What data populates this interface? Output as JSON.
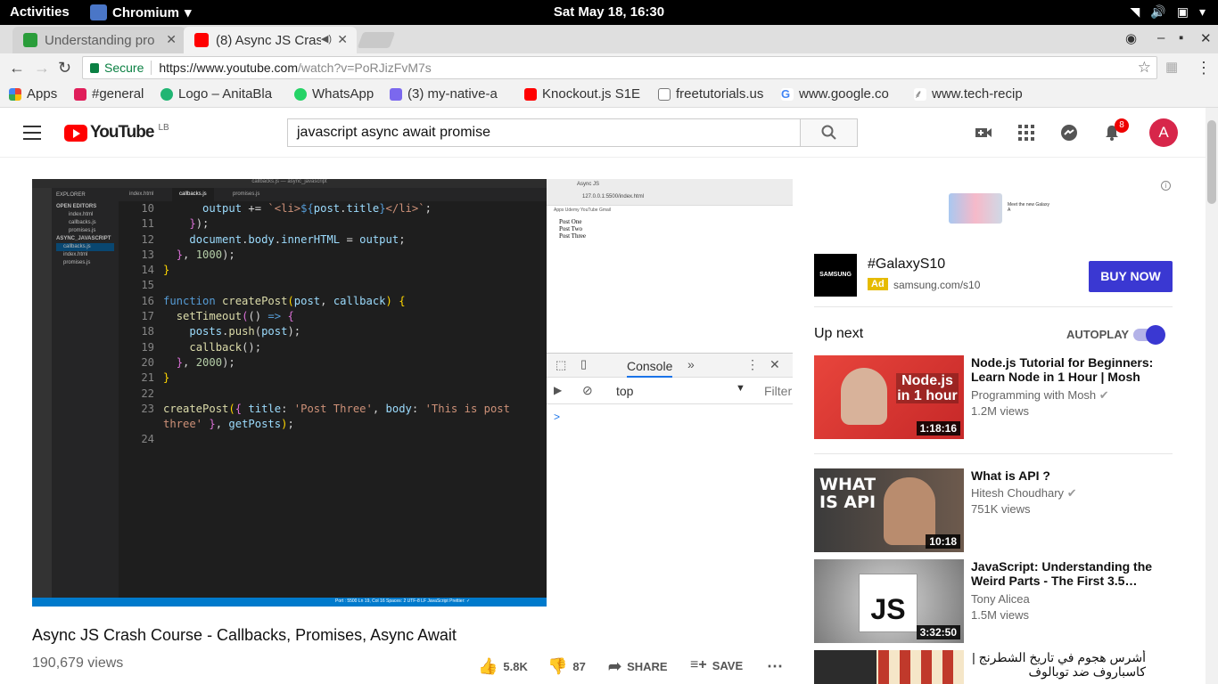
{
  "topbar": {
    "activities": "Activities",
    "app_name": "Chromium",
    "clock": "Sat May 18, 16:30"
  },
  "tabs": [
    {
      "label": "Understanding pro"
    },
    {
      "label": "(8) Async JS Cras"
    }
  ],
  "omnibox": {
    "secure": "Secure",
    "url_host": "https://www.youtube.com",
    "url_path": "/watch?v=PoRJizFvM7s"
  },
  "bookmarks": [
    {
      "label": "Apps",
      "color": "#4285f4"
    },
    {
      "label": "#general",
      "color": "#e01e5a"
    },
    {
      "label": "Logo – AnitaBla",
      "color": "#21b573"
    },
    {
      "label": "WhatsApp",
      "color": "#25d366"
    },
    {
      "label": "(3) my-native-a",
      "color": "#7b68ee"
    },
    {
      "label": "Knockout.js S1E",
      "color": "#ff0000"
    },
    {
      "label": "freetutorials.us",
      "color": "#888888"
    },
    {
      "label": "www.google.co",
      "color": "#4285f4"
    },
    {
      "label": "www.tech-recip",
      "color": "#888888"
    }
  ],
  "youtube": {
    "logo_text": "YouTube",
    "region": "LB",
    "search_value": "javascript async await promise",
    "notification_count": "8",
    "avatar_letter": "A",
    "brand_color": "#ff0000",
    "accent_color": "#3a38d2"
  },
  "player": {
    "window_title": "callbacks.js — async_javascript",
    "explorer": "EXPLORER",
    "open_editors": "OPEN EDITORS",
    "project": "ASYNC_JAVASCRIPT",
    "files": [
      "index.html",
      "callbacks.js",
      "promises.js"
    ],
    "editor_tabs": [
      "index.html",
      "callbacks.js",
      "promises.js"
    ],
    "statusbar": "Port : 5500   Ln 19, Col 16   Spaces: 2   UTF-8   LF   JavaScript   Prettier: ✓",
    "browser_tab": "Async JS",
    "browser_url": "127.0.0.1:5500/index.html",
    "browser_bookmarks": "Apps  Udemy  YouTube  Gmail",
    "page_list": [
      "Post One",
      "Post Two",
      "Post Three"
    ],
    "devtools_tab": "Console",
    "devtools_context": "top",
    "devtools_filter": "Filter",
    "prompt": ">"
  },
  "video": {
    "title": "Async JS Crash Course - Callbacks, Promises, Async Await",
    "views": "190,679 views",
    "likes": "5.8K",
    "dislikes": "87",
    "share": "SHARE",
    "save": "SAVE"
  },
  "ad": {
    "banner_text": "Meet the new Galaxy A",
    "advertiser": "SAMSUNG",
    "title": "#GalaxyS10",
    "ad_label": "Ad",
    "url": "samsung.com/s10",
    "cta": "BUY NOW"
  },
  "sidebar": {
    "up_next": "Up next",
    "autoplay": "AUTOPLAY",
    "autoplay_on": true,
    "videos": [
      {
        "title": "Node.js Tutorial for Beginners: Learn Node in 1 Hour | Mosh",
        "channel": "Programming with Mosh",
        "views": "1.2M views",
        "duration": "1:18:16",
        "thumb_text": "Node.js in 1 hour"
      },
      {
        "title": "What is API ?",
        "channel": "Hitesh Choudhary",
        "views": "751K views",
        "duration": "10:18",
        "thumb_text": "WHAT IS API"
      },
      {
        "title": "JavaScript: Understanding the Weird Parts - The First 3.5…",
        "channel": "Tony Alicea",
        "views": "1.5M views",
        "duration": "3:32:50",
        "thumb_text": "JS"
      },
      {
        "title": "أشرس هجوم في تاريخ الشطرنج | كاسباروف ضد توبالوف",
        "channel": "",
        "views": "",
        "duration": "",
        "thumb_text": ""
      }
    ]
  }
}
